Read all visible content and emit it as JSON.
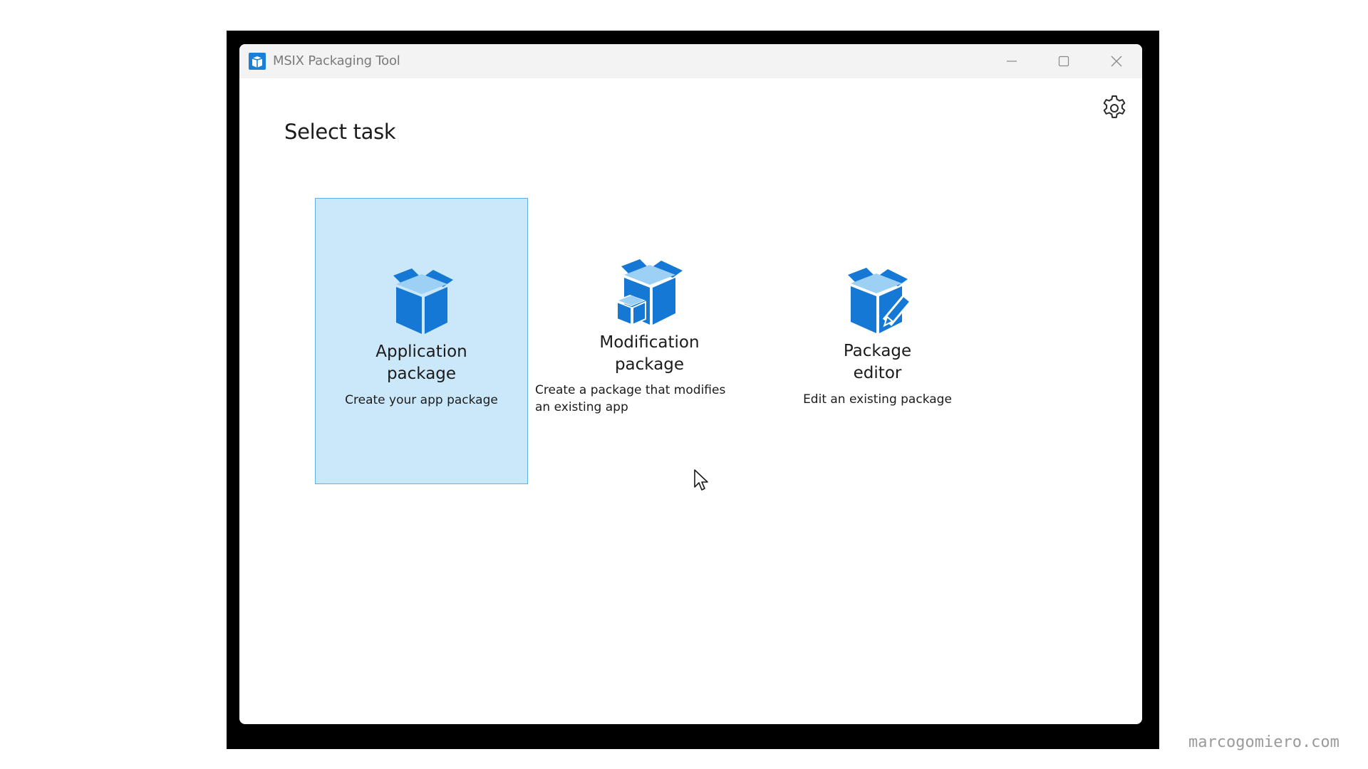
{
  "window": {
    "title": "MSIX Packaging Tool",
    "icon": "msix-app-icon",
    "controls": {
      "minimize_icon": "minimize-icon",
      "maximize_icon": "maximize-icon",
      "close_icon": "close-icon"
    }
  },
  "header": {
    "settings_icon": "gear-icon"
  },
  "main": {
    "title": "Select task",
    "tasks": [
      {
        "title_line1": "Application",
        "title_line2": "package",
        "description": "Create your app package",
        "icon": "package-icon",
        "selected": true
      },
      {
        "title_line1": "Modification",
        "title_line2": "package",
        "description_line1": "Create a package that modifies",
        "description_line2": "an existing app",
        "icon": "modification-package-icon",
        "selected": false
      },
      {
        "title_line1": "Package",
        "title_line2": "editor",
        "description": "Edit an existing package",
        "icon": "package-editor-icon",
        "selected": false
      }
    ]
  },
  "colors": {
    "accent": "#0078d4",
    "selected_card_bg": "#cbe8fa",
    "selected_card_border": "#5fb1e6"
  },
  "watermark": "marcogomiero.com"
}
